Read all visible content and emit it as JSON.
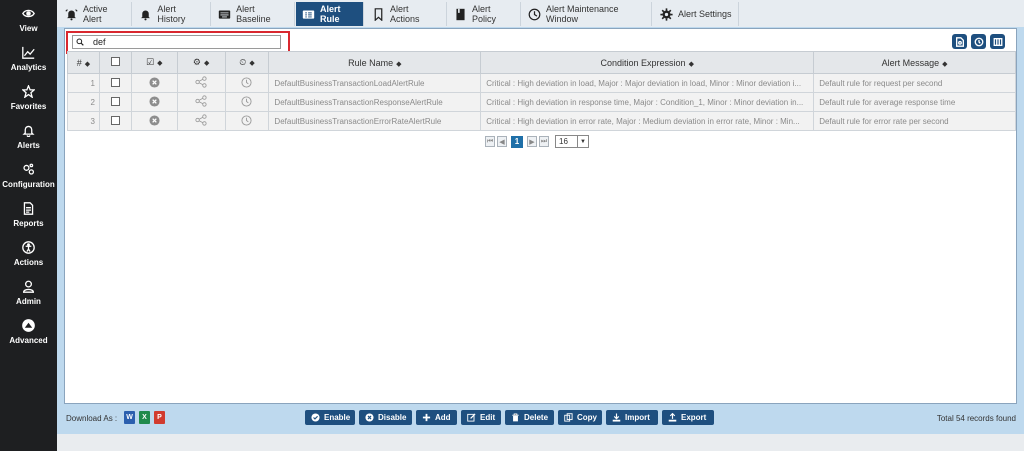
{
  "sidebar": {
    "items": [
      {
        "label": "View",
        "icon": "eye-icon"
      },
      {
        "label": "Analytics",
        "icon": "chart-line-icon"
      },
      {
        "label": "Favorites",
        "icon": "star-icon"
      },
      {
        "label": "Alerts",
        "icon": "bell-icon"
      },
      {
        "label": "Configuration",
        "icon": "gears-icon"
      },
      {
        "label": "Reports",
        "icon": "document-icon"
      },
      {
        "label": "Actions",
        "icon": "accessibility-icon"
      },
      {
        "label": "Admin",
        "icon": "user-icon"
      },
      {
        "label": "Advanced",
        "icon": "up-arrow-circle-icon"
      }
    ]
  },
  "tabs": [
    {
      "label": "Active Alert",
      "icon": "alarm-bell-icon",
      "active": false
    },
    {
      "label": "Alert History",
      "icon": "bell-icon",
      "active": false
    },
    {
      "label": "Alert Baseline",
      "icon": "keyboard-icon",
      "active": false
    },
    {
      "label": "Alert Rule",
      "icon": "rule-list-icon",
      "active": true
    },
    {
      "label": "Alert Actions",
      "icon": "bookmark-icon",
      "active": false
    },
    {
      "label": "Alert Policy",
      "icon": "policy-doc-icon",
      "active": false
    },
    {
      "label": "Alert Maintenance Window",
      "icon": "maintenance-clock-icon",
      "active": false
    },
    {
      "label": "Alert Settings",
      "icon": "gear-icon",
      "active": false
    }
  ],
  "search": {
    "value": "def",
    "placeholder": ""
  },
  "table": {
    "headers": {
      "index": "#",
      "rule_name": "Rule Name",
      "condition": "Condition Expression",
      "message": "Alert Message"
    },
    "rows": [
      {
        "index": "1",
        "rule_name": "DefaultBusinessTransactionLoadAlertRule",
        "condition": "Critical : High deviation in load, Major : Major deviation in load, Minor : Minor deviation i...",
        "message": "Default rule for request per second"
      },
      {
        "index": "2",
        "rule_name": "DefaultBusinessTransactionResponseAlertRule",
        "condition": "Critical : High deviation in response time, Major : Condition_1, Minor : Minor deviation in...",
        "message": "Default rule for average response time"
      },
      {
        "index": "3",
        "rule_name": "DefaultBusinessTransactionErrorRateAlertRule",
        "condition": "Critical : High deviation in error rate, Major : Medium deviation in error rate, Minor : Min...",
        "message": "Default rule for error rate per second"
      }
    ]
  },
  "pager": {
    "current": "1",
    "page_size": "16"
  },
  "footer": {
    "download_label": "Download As :",
    "buttons": {
      "enable": "Enable",
      "disable": "Disable",
      "add": "Add",
      "edit": "Edit",
      "delete": "Delete",
      "copy": "Copy",
      "import": "Import",
      "export": "Export"
    },
    "total": "Total 54 records found"
  },
  "colors": {
    "accent": "#1e4f7f",
    "sidebar": "#1e1f21",
    "highlight": "#d9282f",
    "main_bg": "#bed9ee"
  }
}
